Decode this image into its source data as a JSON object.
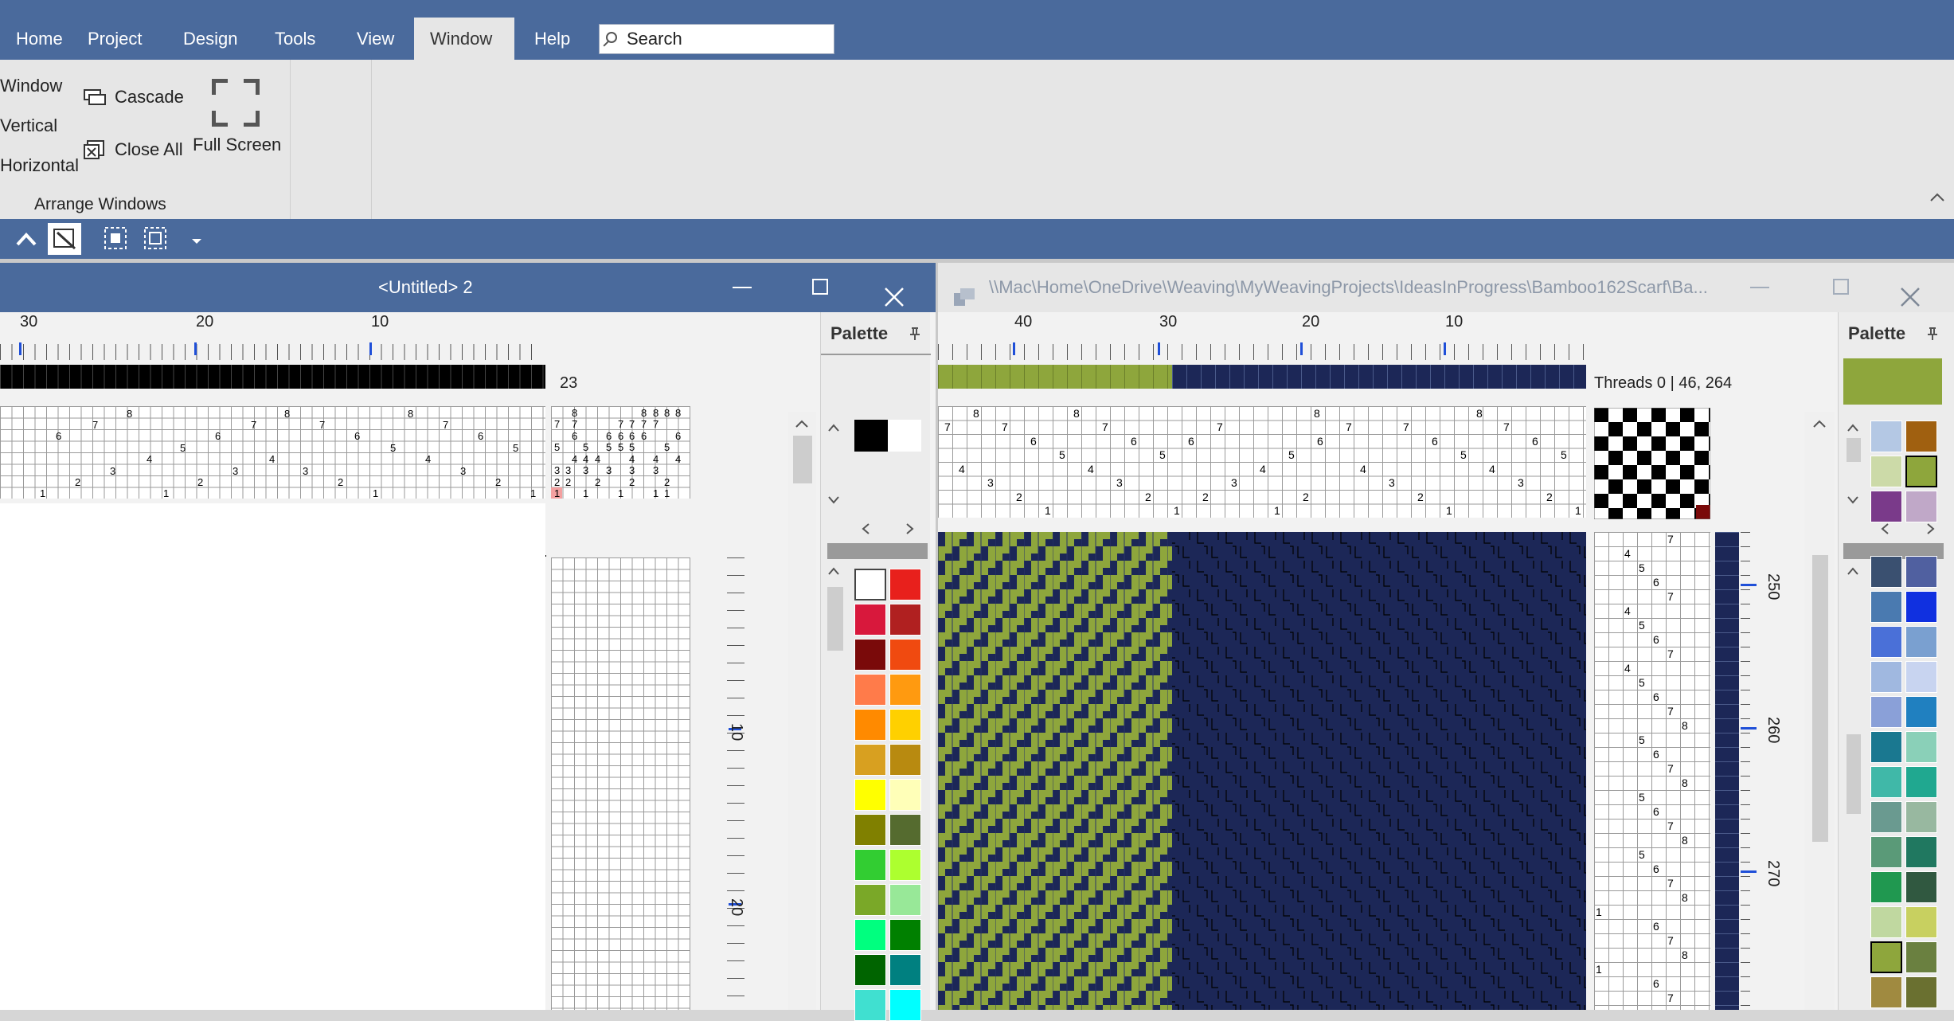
{
  "ribbon": {
    "tabs": [
      "Home",
      "Project",
      "Design",
      "Tools",
      "View",
      "Window",
      "Help"
    ],
    "active_tab": "Window",
    "search_placeholder": "Search",
    "window_group": {
      "new_window": "Window",
      "vertical": "Vertical",
      "horizontal": "Horizontal",
      "cascade": "Cascade",
      "close_all": "Close All",
      "full_screen": "Full Screen",
      "group_label": "Arrange Windows"
    }
  },
  "window1": {
    "title": "<Untitled> 2",
    "ruler_labels": [
      "30",
      "20",
      "10"
    ],
    "thread_count_label": "23",
    "palette_title": "Palette",
    "side_ruler_labels": [
      "10",
      "20"
    ]
  },
  "window2": {
    "title": "\\\\Mac\\Home\\OneDrive\\Weaving\\MyWeavingProjects\\IdeasInProgress\\Bamboo162Scarf\\Ba...",
    "ruler_labels": [
      "40",
      "30",
      "20",
      "10"
    ],
    "threads_info": "Threads 0 | 46, 264",
    "palette_title": "Palette",
    "side_ruler_labels": [
      "250",
      "260",
      "270"
    ]
  },
  "colors": {
    "chrome_blue": "#4a6a9c",
    "navy": "#1c2757",
    "olive_green": "#8ea63c",
    "selected_palette_color": "#8ea63c"
  }
}
